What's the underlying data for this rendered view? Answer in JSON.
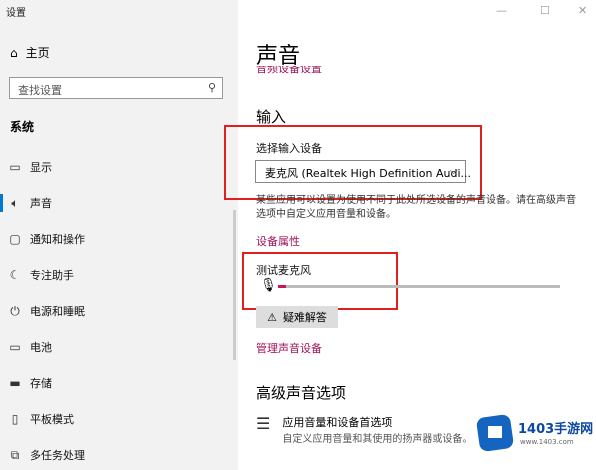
{
  "window": {
    "title": "设置",
    "min": "—",
    "max": "☐",
    "close": "✕"
  },
  "sidebar": {
    "home": "主页",
    "search_placeholder": "查找设置",
    "section": "系统",
    "items": [
      {
        "label": "显示",
        "icon": "monitor-icon"
      },
      {
        "label": "声音",
        "icon": "speaker-icon"
      },
      {
        "label": "通知和操作",
        "icon": "notification-icon"
      },
      {
        "label": "专注助手",
        "icon": "moon-icon"
      },
      {
        "label": "电源和睡眠",
        "icon": "power-icon"
      },
      {
        "label": "电池",
        "icon": "battery-icon"
      },
      {
        "label": "存储",
        "icon": "storage-icon"
      },
      {
        "label": "平板模式",
        "icon": "tablet-icon"
      },
      {
        "label": "多任务处理",
        "icon": "multitask-icon"
      }
    ]
  },
  "main": {
    "title": "声音",
    "clipped_link": "音频设备设置",
    "input_heading": "输入",
    "choose_input_label": "选择输入设备",
    "input_device": "麦克风 (Realtek High Definition Audi...",
    "description": "某些应用可以设置为使用不同于此处所选设备的声音设备。请在高级声音选项中自定义应用音量和设备。",
    "device_properties": "设备属性",
    "test_mic_label": "测试麦克风",
    "mic_level": 0.03,
    "troubleshoot": "疑难解答",
    "manage_devices": "管理声音设备",
    "advanced_heading": "高级声音选项",
    "app_volume_title": "应用音量和设备首选项",
    "app_volume_sub": "自定义应用音量和其使用的扬声器或设备。"
  },
  "watermark": {
    "brand": "1403手游网",
    "url": "www.1403.com"
  },
  "colors": {
    "accent": "#0078d4",
    "link": "#a0135a",
    "highlight_box": "#e02020",
    "mic_fill": "#c2185b"
  }
}
